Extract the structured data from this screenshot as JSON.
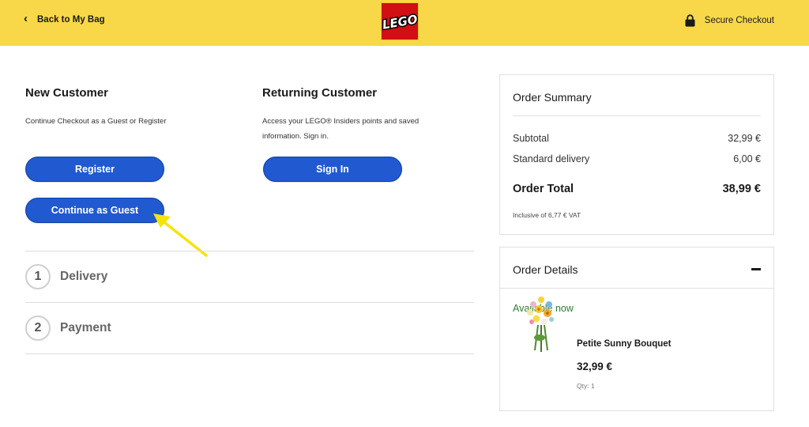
{
  "header": {
    "back_label": "Back to My Bag",
    "logo_text": "LEGO",
    "secure_label": "Secure Checkout"
  },
  "new_customer": {
    "title": "New Customer",
    "description": "Continue Checkout as a Guest or Register",
    "register_label": "Register",
    "guest_label": "Continue as Guest"
  },
  "returning_customer": {
    "title": "Returning Customer",
    "description_line1": "Access your LEGO® Insiders points and saved",
    "description_line2": "information. Sign in.",
    "signin_label": "Sign In"
  },
  "steps": [
    {
      "number": "1",
      "label": "Delivery"
    },
    {
      "number": "2",
      "label": "Payment"
    }
  ],
  "order_summary": {
    "title": "Order Summary",
    "subtotal_label": "Subtotal",
    "subtotal_value": "32,99 €",
    "delivery_label": "Standard delivery",
    "delivery_value": "6,00 €",
    "total_label": "Order Total",
    "total_value": "38,99 €",
    "vat_note": "Inclusive of 6,77 € VAT"
  },
  "order_details": {
    "title": "Order Details",
    "availability": "Available now",
    "product": {
      "name": "Petite Sunny Bouquet",
      "price": "32,99 €",
      "qty": "Qty: 1"
    }
  },
  "colors": {
    "header_bg": "#f8d849",
    "button_blue": "#2159d1",
    "lego_red": "#d01012",
    "available_green": "#2e7d32",
    "annotation_arrow": "#f5e40a"
  }
}
